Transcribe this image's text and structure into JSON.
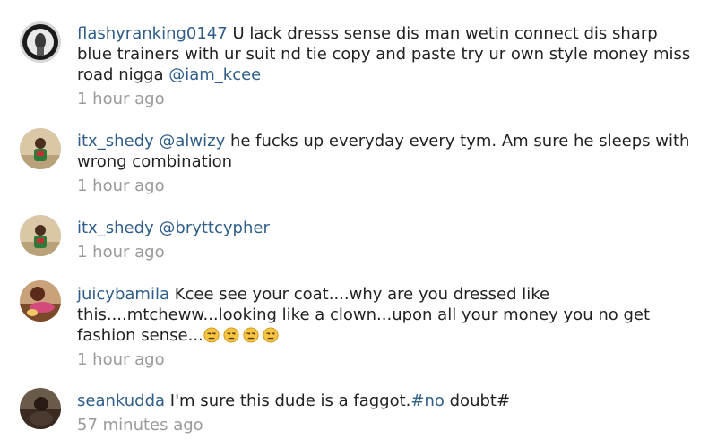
{
  "comments": [
    {
      "username": "flashyranking0147",
      "segments": [
        {
          "type": "text",
          "text": "U lack dresss sense dis man wetin connect dis sharp blue trainers with ur suit nd tie copy and paste try ur own style money miss road nigga "
        },
        {
          "type": "mention",
          "text": "@iam_kcee"
        }
      ],
      "time": "1 hour ago",
      "avatar": "avatar-flashyranking0147"
    },
    {
      "username": "itx_shedy",
      "segments": [
        {
          "type": "mention",
          "text": "@alwizy"
        },
        {
          "type": "text",
          "text": " he fucks up everyday every tym.  Am sure he sleeps with wrong combination"
        }
      ],
      "time": "1 hour ago",
      "avatar": "avatar-itx_shedy"
    },
    {
      "username": "itx_shedy",
      "segments": [
        {
          "type": "mention",
          "text": "@bryttcypher"
        }
      ],
      "time": "1 hour ago",
      "avatar": "avatar-itx_shedy"
    },
    {
      "username": "juicybamila",
      "segments": [
        {
          "type": "text",
          "text": "Kcee see your coat....why are you dressed like this....mtcheww...looking like a clown...upon all your money you no get fashion sense..."
        },
        {
          "type": "emoji",
          "count": 4,
          "name": "unamused-face-emoji"
        }
      ],
      "time": "1 hour ago",
      "avatar": "avatar-juicybamila"
    },
    {
      "username": "seankudda",
      "segments": [
        {
          "type": "text",
          "text": "I'm sure this dude is a faggot."
        },
        {
          "type": "mention",
          "text": "#no"
        },
        {
          "type": "text",
          "text": " doubt#"
        }
      ],
      "time": "57 minutes ago",
      "avatar": "avatar-seankudda"
    }
  ],
  "colors": {
    "username": "#2f5e8a",
    "mention": "#2f5e8a",
    "text": "#222222",
    "time": "#9a9a9a"
  }
}
